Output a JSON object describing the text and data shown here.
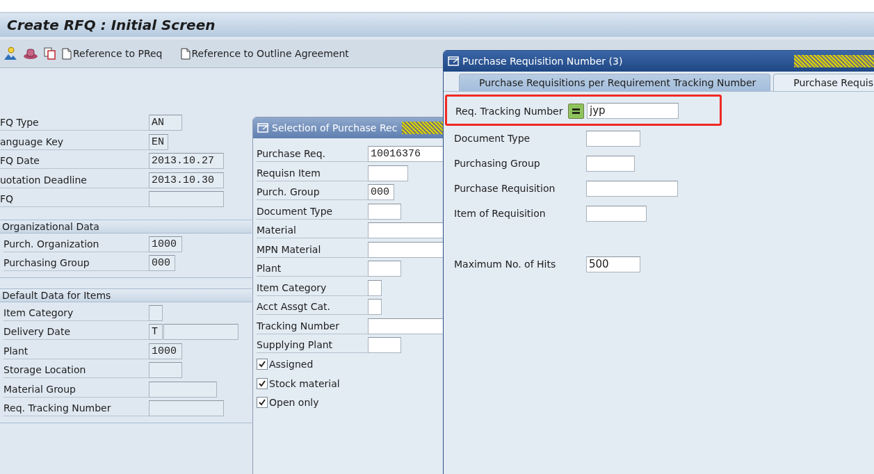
{
  "screen": {
    "title": "Create RFQ : Initial Screen"
  },
  "toolbar": {
    "buttons": [
      {
        "label": "Reference to PReq"
      },
      {
        "label": "Reference to Outline Agreement"
      }
    ]
  },
  "header_fields": [
    {
      "label": "FQ Type",
      "value": "AN"
    },
    {
      "label": "anguage Key",
      "value": "EN"
    },
    {
      "label": "FQ Date",
      "value": "2013.10.27"
    },
    {
      "label": "uotation Deadline",
      "value": "2013.10.30"
    },
    {
      "label": "FQ"
    }
  ],
  "groups": [
    {
      "title": "Organizational Data",
      "fields": [
        {
          "label": "Purch. Organization",
          "value": "1000"
        },
        {
          "label": "Purchasing Group",
          "value": "000"
        }
      ]
    },
    {
      "title": "Default Data for Items",
      "fields": [
        {
          "label": "Item Category"
        },
        {
          "label": "Delivery Date",
          "value": "T"
        },
        {
          "label": "Plant",
          "value": "1000"
        },
        {
          "label": "Storage Location"
        },
        {
          "label": "Material Group"
        },
        {
          "label": "Req. Tracking Number"
        }
      ]
    }
  ],
  "selection_dialog": {
    "title": "Selection of Purchase Rec",
    "fields": [
      {
        "label": "Purchase Req.",
        "value": "10016376"
      },
      {
        "label": "Requisn Item"
      },
      {
        "label": "Purch. Group",
        "value": "000"
      },
      {
        "label": "Document Type"
      },
      {
        "label": "Material"
      },
      {
        "label": "MPN Material"
      },
      {
        "label": "Plant"
      },
      {
        "label": "Item Category"
      },
      {
        "label": "Acct Assgt Cat."
      },
      {
        "label": "Tracking Number"
      },
      {
        "label": "Supplying Plant"
      }
    ],
    "checkboxes": [
      {
        "label": "Assigned",
        "checked": true
      },
      {
        "label": "Stock material",
        "checked": true
      },
      {
        "label": "Open only",
        "checked": true
      }
    ]
  },
  "number_dialog": {
    "title": "Purchase Requisition Number (3)",
    "tabs": [
      {
        "label": "Purchase Requisitions per Requirement Tracking Number",
        "selected": true
      },
      {
        "label": "Purchase Requis",
        "selected": false
      }
    ],
    "fields": [
      {
        "label": "Req. Tracking Number",
        "value": "jyp",
        "highlighted": true
      },
      {
        "label": "Document Type",
        "highlighted": false
      },
      {
        "label": "Purchasing Group",
        "highlighted": false
      },
      {
        "label": "Purchase Requisition",
        "highlighted": false
      },
      {
        "label": "Item of Requisition",
        "highlighted": false
      },
      {
        "label": "Maximum No. of Hits",
        "value": "500",
        "highlighted": false
      }
    ]
  }
}
